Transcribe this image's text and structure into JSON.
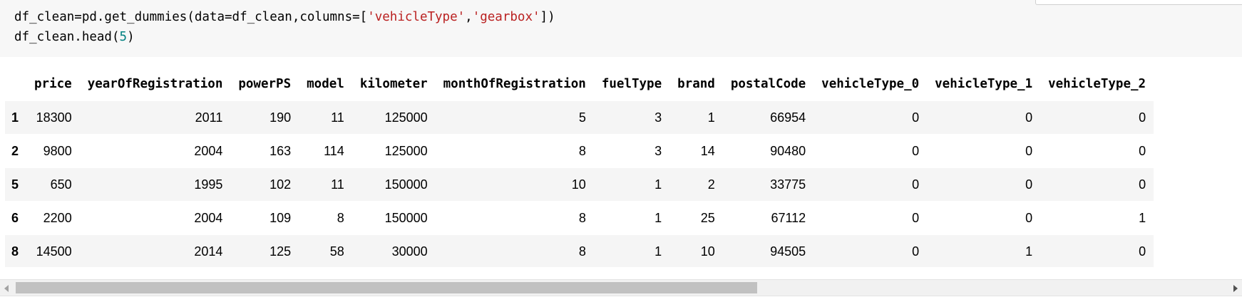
{
  "code": {
    "line1": {
      "pre": "df_clean=pd.get_dummies(data=df_clean,columns=[",
      "str1": "'vehicleType'",
      "comma": ",",
      "str2": "'gearbox'",
      "post": "])"
    },
    "line2": {
      "pre": "df_clean.head(",
      "num": "5",
      "post": ")"
    }
  },
  "table": {
    "columns": [
      "",
      "price",
      "yearOfRegistration",
      "powerPS",
      "model",
      "kilometer",
      "monthOfRegistration",
      "fuelType",
      "brand",
      "postalCode",
      "vehicleType_0",
      "vehicleType_1",
      "vehicleType_2"
    ],
    "rows": [
      [
        "1",
        "18300",
        "2011",
        "190",
        "11",
        "125000",
        "5",
        "3",
        "1",
        "66954",
        "0",
        "0",
        "0"
      ],
      [
        "2",
        "9800",
        "2004",
        "163",
        "114",
        "125000",
        "8",
        "3",
        "14",
        "90480",
        "0",
        "0",
        "0"
      ],
      [
        "5",
        "650",
        "1995",
        "102",
        "11",
        "150000",
        "10",
        "1",
        "2",
        "33775",
        "0",
        "0",
        "0"
      ],
      [
        "6",
        "2200",
        "2004",
        "109",
        "8",
        "150000",
        "8",
        "1",
        "25",
        "67112",
        "0",
        "0",
        "1"
      ],
      [
        "8",
        "14500",
        "2014",
        "125",
        "58",
        "30000",
        "8",
        "1",
        "10",
        "94505",
        "0",
        "1",
        "0"
      ]
    ]
  },
  "scrollbar": {
    "left_arrow_icon": "triangle-left",
    "right_arrow_icon": "triangle-right"
  }
}
